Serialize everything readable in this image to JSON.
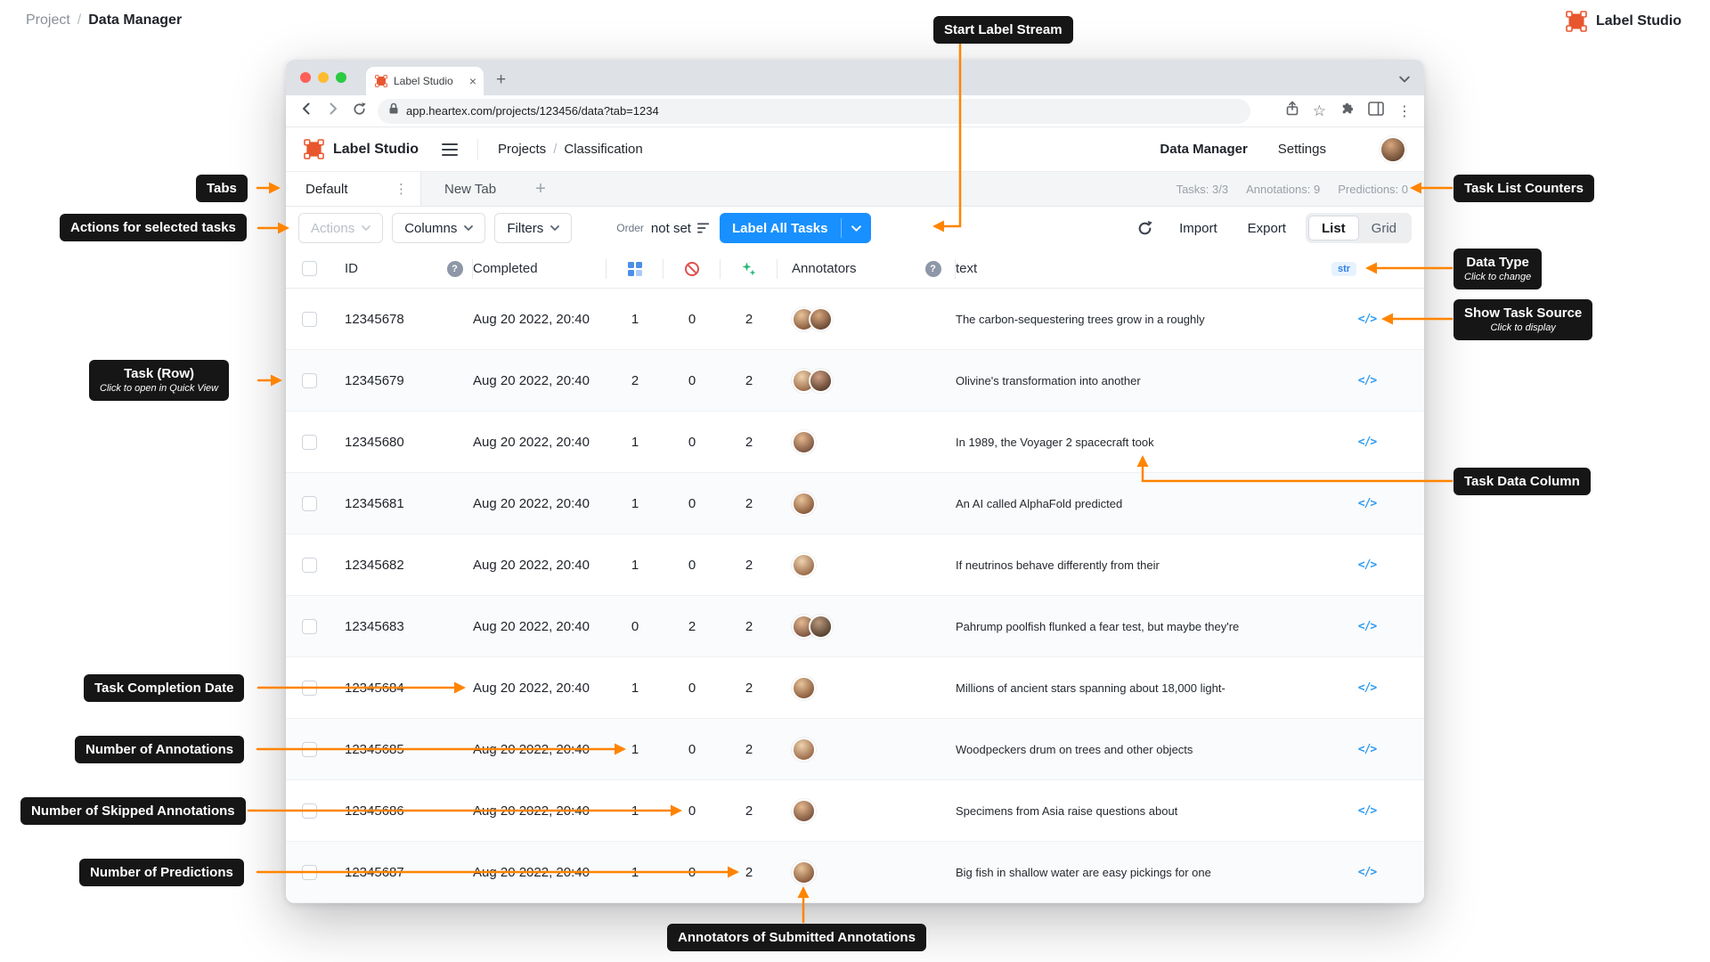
{
  "page": {
    "breadcrumb_project": "Project",
    "breadcrumb_sep": "/",
    "breadcrumb_current": "Data Manager",
    "brand_name": "Label Studio"
  },
  "browser": {
    "tab_title": "Label Studio",
    "url": "app.heartex.com/projects/123456/data?tab=1234"
  },
  "app": {
    "logo_text": "Label Studio",
    "crumb_projects": "Projects",
    "crumb_sep": "/",
    "crumb_current": "Classification",
    "nav_data_manager": "Data Manager",
    "nav_settings": "Settings"
  },
  "view_tabs": {
    "default_tab": "Default",
    "new_tab": "New Tab",
    "counter_tasks": "Tasks: 3/3",
    "counter_annotations": "Annotations: 9",
    "counter_predictions": "Predictions: 0"
  },
  "toolbar": {
    "actions": "Actions",
    "columns": "Columns",
    "filters": "Filters",
    "order_label": "Order",
    "order_value": "not set",
    "label_all": "Label All Tasks",
    "import": "Import",
    "export": "Export",
    "list": "List",
    "grid": "Grid"
  },
  "table": {
    "header_id": "ID",
    "header_completed": "Completed",
    "header_annotators": "Annotators",
    "header_text": "text",
    "data_type_badge": "str",
    "rows": [
      {
        "id": "12345678",
        "completed": "Aug 20 2022, 20:40",
        "annotations": "1",
        "skipped": "0",
        "predictions": "2",
        "annotators": 2,
        "text": "The carbon-sequestering trees grow in a roughly"
      },
      {
        "id": "12345679",
        "completed": "Aug 20 2022, 20:40",
        "annotations": "2",
        "skipped": "0",
        "predictions": "2",
        "annotators": 2,
        "text": "Olivine's transformation into another"
      },
      {
        "id": "12345680",
        "completed": "Aug 20 2022, 20:40",
        "annotations": "1",
        "skipped": "0",
        "predictions": "2",
        "annotators": 1,
        "text": "In 1989, the Voyager 2 spacecraft took"
      },
      {
        "id": "12345681",
        "completed": "Aug 20 2022, 20:40",
        "annotations": "1",
        "skipped": "0",
        "predictions": "2",
        "annotators": 1,
        "text": "An AI called AlphaFold predicted"
      },
      {
        "id": "12345682",
        "completed": "Aug 20 2022, 20:40",
        "annotations": "1",
        "skipped": "0",
        "predictions": "2",
        "annotators": 1,
        "text": "If neutrinos behave differently from their"
      },
      {
        "id": "12345683",
        "completed": "Aug 20 2022, 20:40",
        "annotations": "0",
        "skipped": "2",
        "predictions": "2",
        "annotators": 2,
        "text": "Pahrump poolfish flunked a fear test, but maybe they're"
      },
      {
        "id": "12345684",
        "completed": "Aug 20 2022, 20:40",
        "annotations": "1",
        "skipped": "0",
        "predictions": "2",
        "annotators": 1,
        "text": "Millions of ancient stars spanning about 18,000 light-"
      },
      {
        "id": "12345685",
        "completed": "Aug 20 2022, 20:40",
        "annotations": "1",
        "skipped": "0",
        "predictions": "2",
        "annotators": 1,
        "text": "Woodpeckers drum on trees and other objects"
      },
      {
        "id": "12345686",
        "completed": "Aug 20 2022, 20:40",
        "annotations": "1",
        "skipped": "0",
        "predictions": "2",
        "annotators": 1,
        "text": "Specimens from Asia raise questions about"
      },
      {
        "id": "12345687",
        "completed": "Aug 20 2022, 20:40",
        "annotations": "1",
        "skipped": "0",
        "predictions": "2",
        "annotators": 1,
        "text": "Big fish in shallow water are easy pickings for one"
      }
    ]
  },
  "callouts": {
    "start_label_stream": "Start Label Stream",
    "tabs": "Tabs",
    "actions_for_selected": "Actions for selected tasks",
    "task_list_counters": "Task List Counters",
    "data_type_title": "Data Type",
    "data_type_sub": "Click to change",
    "show_task_source_title": "Show Task Source",
    "show_task_source_sub": "Click to display",
    "task_row_title": "Task (Row)",
    "task_row_sub": "Click to open in Quick View",
    "task_data_column": "Task Data Column",
    "task_completion_date": "Task Completion Date",
    "number_of_annotations": "Number of Annotations",
    "number_of_skipped_annotations": "Number of Skipped Annotations",
    "number_of_predictions": "Number of Predictions",
    "annotators_of_submitted": "Annotators of Submitted Annotations"
  },
  "icons": {
    "code": "</>",
    "overflow": "⋮",
    "close": "×",
    "star": "☆",
    "browser_menu": "⋮",
    "plus_tab": "+"
  },
  "colors": {
    "accent_orange": "#FF8400",
    "primary_blue": "#1890FF",
    "annotations_blue": "#4C8FE8",
    "skipped_red": "#E04F4F",
    "predictions_green": "#27B877",
    "callout_bg": "#161616",
    "logo_orange": "#E8562E"
  }
}
